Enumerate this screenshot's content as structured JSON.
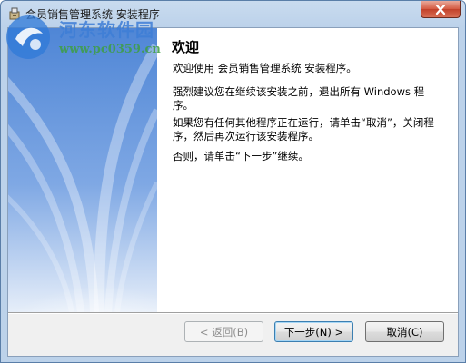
{
  "window": {
    "title": "会员销售管理系统 安装程序"
  },
  "watermark": {
    "site_name": "河东软件园",
    "url": "www.pc0359.cn"
  },
  "content": {
    "heading": "欢迎",
    "paragraph1": "欢迎使用 会员销售管理系统  安装程序。",
    "paragraph2": "强烈建议您在继续该安装之前，退出所有 Windows 程序。",
    "paragraph3": "如果您有任何其他程序正在运行，请单击“取消”，关闭程序，然后再次运行该安装程序。",
    "paragraph4": "否则，请单击“下一步”继续。"
  },
  "buttons": {
    "back_label": "< 返回(B)",
    "next_label": "下一步(N) >",
    "cancel_label": "取消(C)"
  },
  "colors": {
    "side_gradient_top": "#4f86d6",
    "side_gradient_bottom": "#e6eef9",
    "close_button": "#c94a34"
  }
}
